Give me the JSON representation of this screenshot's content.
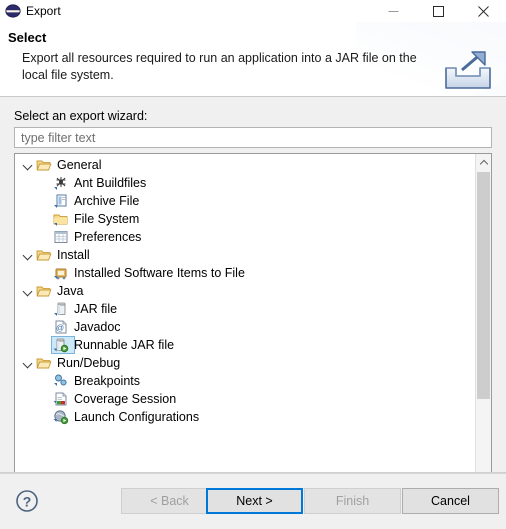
{
  "window": {
    "title": "Export",
    "icon": "eclipse-logo-icon",
    "controls": [
      {
        "name": "minimize-button",
        "glyph": "minimize-icon"
      },
      {
        "name": "maximize-button",
        "glyph": "maximize-icon"
      },
      {
        "name": "close-button",
        "glyph": "close-icon"
      }
    ]
  },
  "header": {
    "title": "Select",
    "description": "Export all resources required to run an application into a JAR file on the local file system.",
    "icon": "export-wizard-icon"
  },
  "form": {
    "wizard_label": "Select an export wizard:",
    "filter_placeholder": "type filter text",
    "filter_value": ""
  },
  "tree": {
    "selected": "Runnable JAR file",
    "nodes": [
      {
        "label": "General",
        "type": "category",
        "icon": "open-folder-icon",
        "expanded": true,
        "chevron": "chevron-down-icon"
      },
      {
        "label": "Ant Buildfiles",
        "type": "leaf",
        "icon": "ant-buildfile-icon"
      },
      {
        "label": "Archive File",
        "type": "leaf",
        "icon": "archive-file-icon"
      },
      {
        "label": "File System",
        "type": "leaf",
        "icon": "file-system-folder-icon"
      },
      {
        "label": "Preferences",
        "type": "leaf",
        "icon": "preferences-icon"
      },
      {
        "label": "Install",
        "type": "category",
        "icon": "open-folder-icon",
        "expanded": true,
        "chevron": "chevron-down-icon"
      },
      {
        "label": "Installed Software Items to File",
        "type": "leaf",
        "icon": "installed-software-icon"
      },
      {
        "label": "Java",
        "type": "category",
        "icon": "open-folder-icon",
        "expanded": true,
        "chevron": "chevron-down-icon"
      },
      {
        "label": "JAR file",
        "type": "leaf",
        "icon": "jar-file-icon"
      },
      {
        "label": "Javadoc",
        "type": "leaf",
        "icon": "javadoc-icon"
      },
      {
        "label": "Runnable JAR file",
        "type": "leaf",
        "icon": "runnable-jar-icon",
        "selected": true
      },
      {
        "label": "Run/Debug",
        "type": "category",
        "icon": "open-folder-icon",
        "expanded": true,
        "chevron": "chevron-down-icon"
      },
      {
        "label": "Breakpoints",
        "type": "leaf",
        "icon": "breakpoints-icon"
      },
      {
        "label": "Coverage Session",
        "type": "leaf",
        "icon": "coverage-session-icon"
      },
      {
        "label": "Launch Configurations",
        "type": "leaf",
        "icon": "launch-configurations-icon"
      }
    ],
    "scrollbar": {
      "up_arrow": "scroll-up-icon",
      "down_arrow": "scroll-down-icon",
      "thumb_position_percent": 0,
      "thumb_size_percent": 70
    }
  },
  "footer": {
    "help": {
      "label": "?",
      "icon": "help-icon"
    },
    "buttons": [
      {
        "name": "back-button",
        "label": "< Back",
        "enabled": false,
        "focused": false
      },
      {
        "name": "next-button",
        "label": "Next >",
        "enabled": true,
        "focused": true
      },
      {
        "name": "finish-button",
        "label": "Finish",
        "enabled": false,
        "focused": false
      },
      {
        "name": "cancel-button",
        "label": "Cancel",
        "enabled": true,
        "focused": false
      }
    ]
  },
  "colors": {
    "dialog_background": "#f0f0f0",
    "header_background": "#ffffff",
    "tree_background": "#ffffff",
    "selection_fill": "#cde8f7",
    "selection_border": "#7ab3dd",
    "focus_border": "#0078d7",
    "folder_icon": "#e8b54d",
    "disabled_text": "#a0a0a0"
  }
}
